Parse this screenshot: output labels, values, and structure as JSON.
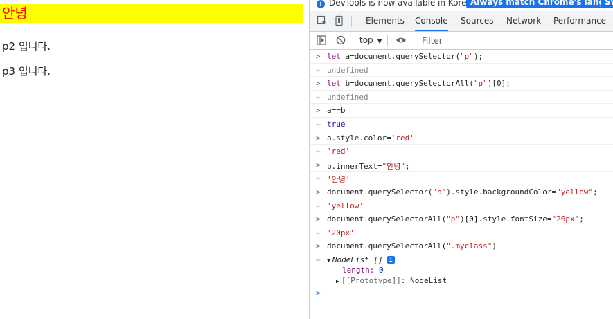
{
  "page": {
    "p1_text": "안녕",
    "p2_text": "p2 입니다.",
    "p3_text": "p3 입니다.",
    "colors": {
      "p1_background": "#ffff00",
      "p1_text": "#ff0000"
    }
  },
  "devtools": {
    "infobar": {
      "message": "DevTools is now available in Korean!",
      "button_primary": "Always match Chrome's language",
      "button_secondary": "Sw"
    },
    "tabs": [
      "Elements",
      "Console",
      "Sources",
      "Network",
      "Performance"
    ],
    "active_tab": "Console",
    "toolbar": {
      "context": "top",
      "filter_placeholder": "Filter"
    },
    "console": {
      "entries": [
        {
          "type": "input",
          "text": "let a=document.querySelector(\"p\");"
        },
        {
          "type": "result",
          "text": "undefined"
        },
        {
          "type": "input",
          "text": "let b=document.querySelectorAll(\"p\")[0];"
        },
        {
          "type": "result",
          "text": "undefined"
        },
        {
          "type": "input",
          "text": "a==b"
        },
        {
          "type": "result",
          "text": "true"
        },
        {
          "type": "input",
          "text": "a.style.color='red'"
        },
        {
          "type": "result",
          "text": "'red'"
        },
        {
          "type": "input",
          "text": "b.innerText=\"안녕\";"
        },
        {
          "type": "result",
          "text": "'안녕'"
        },
        {
          "type": "input",
          "text": "document.querySelector(\"p\").style.backgroundColor=\"yellow\";"
        },
        {
          "type": "result",
          "text": "'yellow'"
        },
        {
          "type": "input",
          "text": "document.querySelectorAll(\"p\")[0].style.fontSize=\"20px\";"
        },
        {
          "type": "result",
          "text": "'20px'"
        },
        {
          "type": "input",
          "text": "document.querySelectorAll(\".myclass\")"
        }
      ],
      "nodelist": {
        "label": "NodeList []",
        "length_key": "length",
        "length_value": "0",
        "prototype_key": "[[Prototype]]",
        "prototype_value": "NodeList"
      }
    }
  }
}
